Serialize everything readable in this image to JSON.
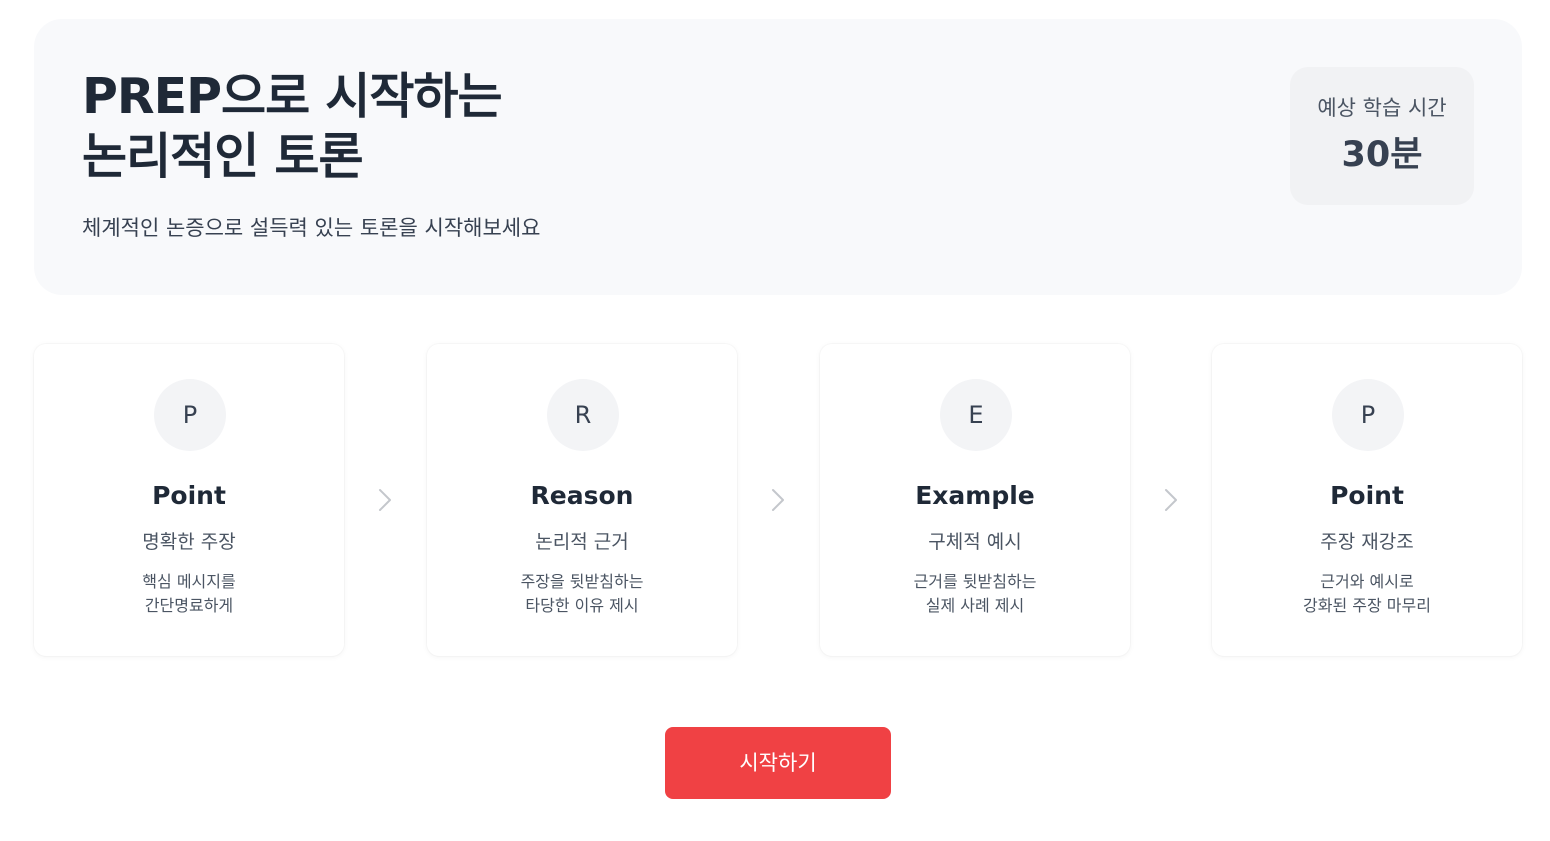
{
  "hero": {
    "title_line1": "PREP으로 시작하는",
    "title_line2": "논리적인 토론",
    "subtitle": "체계적인 논증으로 설득력 있는 토론을 시작해보세요",
    "time_label": "예상 학습 시간",
    "time_value": "30분"
  },
  "steps": [
    {
      "letter": "P",
      "name": "Point",
      "summary": "명확한 주장",
      "desc_line1": "핵심 메시지를",
      "desc_line2": "간단명료하게"
    },
    {
      "letter": "R",
      "name": "Reason",
      "summary": "논리적 근거",
      "desc_line1": "주장을 뒷받침하는",
      "desc_line2": "타당한 이유 제시"
    },
    {
      "letter": "E",
      "name": "Example",
      "summary": "구체적 예시",
      "desc_line1": "근거를 뒷받침하는",
      "desc_line2": "실제 사례 제시"
    },
    {
      "letter": "P",
      "name": "Point",
      "summary": "주장 재강조",
      "desc_line1": "근거와 예시로",
      "desc_line2": "강화된 주장 마무리"
    }
  ],
  "arrow_icon": "chevron-right-icon",
  "start_button_label": "시작하기",
  "colors": {
    "accent": "#f04144",
    "hero_bg": "#f8f9fb",
    "badge_bg": "#f3f4f6"
  }
}
